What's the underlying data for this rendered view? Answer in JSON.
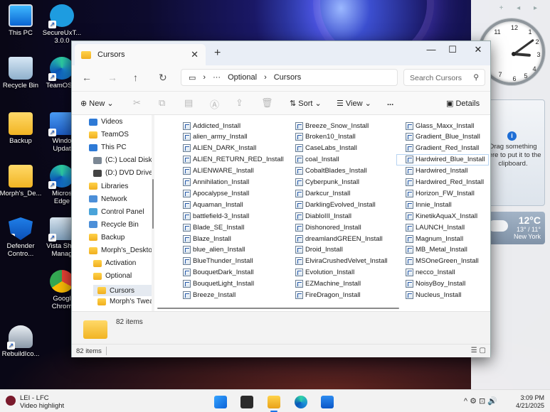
{
  "desktop": {
    "icons": [
      {
        "label": "This PC"
      },
      {
        "label": "SecureUxT...\n3.0.0"
      },
      {
        "label": "Recycle Bin"
      },
      {
        "label": "TeamOS..."
      },
      {
        "label": "Backup"
      },
      {
        "label": "Windo\nUpdat"
      },
      {
        "label": "Morph's_De..."
      },
      {
        "label": "Micros\nEdge"
      },
      {
        "label": "Defender\nContro..."
      },
      {
        "label": "Vista Shor\nManag"
      },
      {
        "label": "Googl\nChrom"
      },
      {
        "label": "RebuildIco..."
      }
    ]
  },
  "gadgets": {
    "clock_numbers": [
      "12",
      "1",
      "2",
      "3",
      "4",
      "5",
      "6",
      "7",
      "11"
    ],
    "clock_time": "3:09",
    "clipboard_text": "Drag something here to put it to the clipboard.",
    "weather": {
      "temp": "12°C",
      "range": "13° / 11°",
      "city": "New York"
    }
  },
  "window": {
    "tab_title": "Cursors",
    "breadcrumb": [
      "Optional",
      "Cursors"
    ],
    "search_placeholder": "Search Cursors",
    "toolbar": {
      "new": "New",
      "sort": "Sort",
      "view": "View",
      "more": "...",
      "details": "Details"
    },
    "nav_items": [
      {
        "label": "Videos",
        "icon": "videos"
      },
      {
        "label": "TeamOS",
        "icon": "folder"
      },
      {
        "label": "This PC",
        "icon": "pc"
      },
      {
        "label": "(C:) Local Disk",
        "icon": "disk"
      },
      {
        "label": "(D:) DVD Drive",
        "icon": "dvd"
      },
      {
        "label": "Libraries",
        "icon": "folder"
      },
      {
        "label": "Network",
        "icon": "network"
      },
      {
        "label": "Control Panel",
        "icon": "control-panel"
      },
      {
        "label": "Recycle Bin",
        "icon": "bin"
      },
      {
        "label": "Backup",
        "icon": "folder"
      },
      {
        "label": "Morph's_Deskto",
        "icon": "folder"
      },
      {
        "label": "Activation",
        "icon": "folder"
      },
      {
        "label": "Optional",
        "icon": "folder"
      },
      {
        "label": "Cursors",
        "icon": "folder",
        "selected": true
      },
      {
        "label": "Morph's Twea",
        "icon": "folder"
      }
    ],
    "files": [
      [
        "Addicted_Install",
        "alien_army_Install",
        "ALIEN_DARK_Install",
        "ALIEN_RETURN_RED_Install",
        "ALIENWARE_Install",
        "Annihilation_Install",
        "Apocalypse_Install",
        "Aquaman_Install",
        "battlefield-3_Install",
        "Blade_SE_Install",
        "Blaze_Install",
        "blue_alien_Install",
        "BlueThunder_Install",
        "BouquetDark_Install",
        "BouquetLight_Install",
        "Breeze_Install"
      ],
      [
        "Breeze_Snow_Install",
        "Broken10_Install",
        "CaseLabs_Install",
        "coal_Install",
        "CobaltBlades_Install",
        "Cyberpunk_Install",
        "Darkcur_Install",
        "DarklingEvolved_Install",
        "DiabloIII_Install",
        "Dishonored_Install",
        "dreamlandGREEN_Install",
        "Droid_Install",
        "ElviraCrushedVelvet_Install",
        "Evolution_Install",
        "EZMachine_Install",
        "FireDragon_Install"
      ],
      [
        "Glass_Maxx_Install",
        "Gradient_Blue_Install",
        "Gradient_Red_Install",
        "Hardwired_Blue_Install",
        "Hardwired_Install",
        "Hardwired_Red_Install",
        "Horizon_FW_Install",
        "Innie_Install",
        "KinetikAquaX_Install",
        "LAUNCH_Install",
        "Magnum_Install",
        "MB_Metal_Install",
        "MSOneGreen_Install",
        "necco_Install",
        "NoisyBoy_Install",
        "Nucleus_Install"
      ]
    ],
    "selected_file": "Hardwired_Blue_Install",
    "details_count": "82 items",
    "status_count": "82 items"
  },
  "taskbar": {
    "news_title": "LEI - LFC",
    "news_sub": "Video highlight",
    "time": "3:09 PM",
    "date": "4/21/2025"
  }
}
